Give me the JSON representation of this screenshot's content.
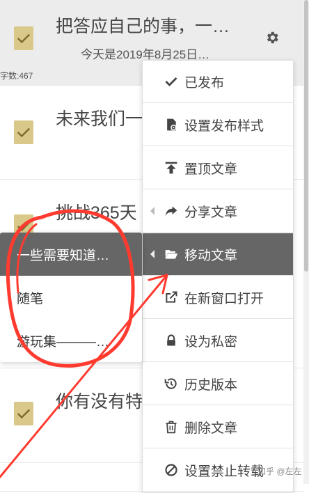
{
  "articles": [
    {
      "title": "把答应自己的事，一…",
      "subtitle": "今天是2019年8月25日…",
      "word_count": "字数:467"
    },
    {
      "title": "未来我们一"
    },
    {
      "title": "挑战365天"
    },
    {
      "title": "你有没有特"
    }
  ],
  "icons": {
    "checkbox": "check-icon",
    "settings": "gear-icon"
  },
  "menu": {
    "items": [
      {
        "label": "已发布",
        "icon": "check-icon"
      },
      {
        "label": "设置发布样式",
        "icon": "file-settings-icon"
      },
      {
        "label": "置顶文章",
        "icon": "pin-top-icon"
      },
      {
        "label": "分享文章",
        "icon": "share-icon"
      },
      {
        "label": "移动文章",
        "icon": "folder-open-icon"
      },
      {
        "label": "在新窗口打开",
        "icon": "external-link-icon"
      },
      {
        "label": "设为私密",
        "icon": "lock-icon"
      },
      {
        "label": "历史版本",
        "icon": "history-icon"
      },
      {
        "label": "删除文章",
        "icon": "trash-icon"
      },
      {
        "label": "设置禁止转载",
        "icon": "ban-icon"
      }
    ]
  },
  "submenu": {
    "items": [
      {
        "label": "一些需要知道…"
      },
      {
        "label": "随笔"
      },
      {
        "label": "游玩集———…"
      }
    ]
  },
  "watermark": "知乎 @左左",
  "colors": {
    "checkbox": "#d8c98a",
    "check": "#7a6a2a",
    "menu_highlight": "#666666",
    "annotation": "#ff3b30"
  }
}
